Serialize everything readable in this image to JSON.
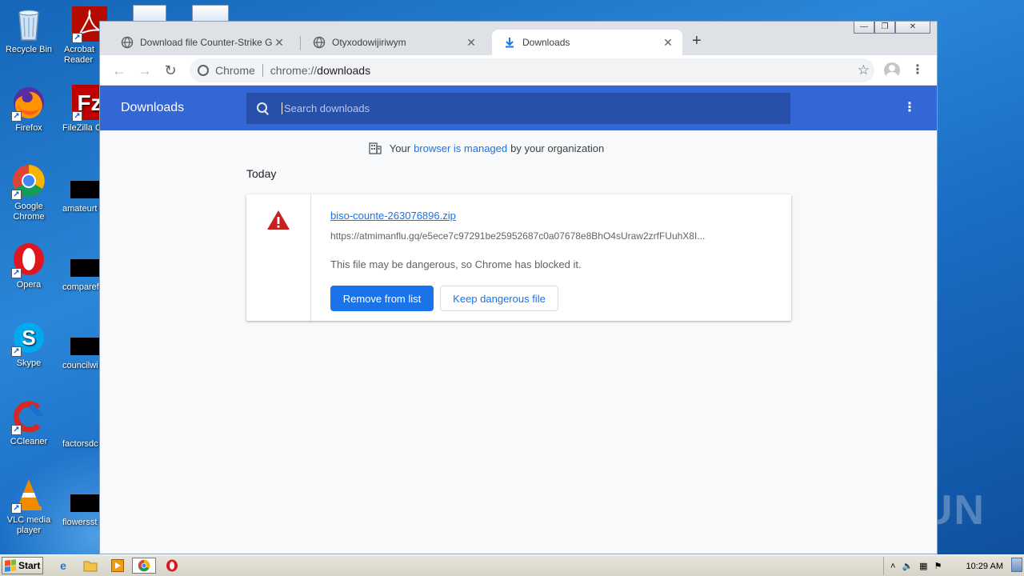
{
  "desktop": {
    "icons": [
      {
        "label": "Recycle Bin",
        "icon": "recycle-bin-icon"
      },
      {
        "label": "Firefox",
        "icon": "firefox-icon"
      },
      {
        "label": "Google Chrome",
        "icon": "chrome-icon"
      },
      {
        "label": "Opera",
        "icon": "opera-icon"
      },
      {
        "label": "Skype",
        "icon": "skype-icon"
      },
      {
        "label": "CCleaner",
        "icon": "ccleaner-icon"
      },
      {
        "label": "VLC media player",
        "icon": "vlc-icon"
      }
    ],
    "column2": [
      {
        "label": "Acrobat Reader",
        "icon": "acrobat-icon"
      },
      {
        "label": "FileZilla Cl",
        "icon": "filezilla-icon"
      },
      {
        "label": "amateurt",
        "icon": "file-icon"
      },
      {
        "label": "comparef",
        "icon": "file-icon"
      },
      {
        "label": "councilwi",
        "icon": "file-icon"
      },
      {
        "label": "factorsdc",
        "icon": "file-icon"
      },
      {
        "label": "flowersst",
        "icon": "file-icon"
      }
    ],
    "watermark": "ANY RUN"
  },
  "browser": {
    "tabs": [
      {
        "title": "Download file Counter-Strike Global O",
        "icon": "globe-icon",
        "active": false
      },
      {
        "title": "Otyxodowijiriwym",
        "icon": "globe-icon",
        "active": false
      },
      {
        "title": "Downloads",
        "icon": "download-icon",
        "active": true
      }
    ],
    "omnibox": {
      "chip": "Chrome",
      "scheme": "chrome://",
      "path": "downloads"
    }
  },
  "downloads_page": {
    "title": "Downloads",
    "search_placeholder": "Search downloads",
    "managed_prefix": "Your",
    "managed_link": "browser is managed",
    "managed_suffix": "by your organization",
    "section_date": "Today",
    "item": {
      "filename": "biso-counte-263076896.zip",
      "url": "https://atmimanflu.gq/e5ece7c97291be25952687c0a07678e8BhO4sUraw2zrfFUuhX8I...",
      "warning": "This file may be dangerous, so Chrome has blocked it.",
      "remove_label": "Remove from list",
      "keep_label": "Keep dangerous file"
    }
  },
  "taskbar": {
    "start_label": "Start",
    "clock": "10:29 AM"
  },
  "colors": {
    "header_blue": "#3367d6",
    "link_blue": "#1a73e8",
    "danger_red": "#c5221f"
  }
}
